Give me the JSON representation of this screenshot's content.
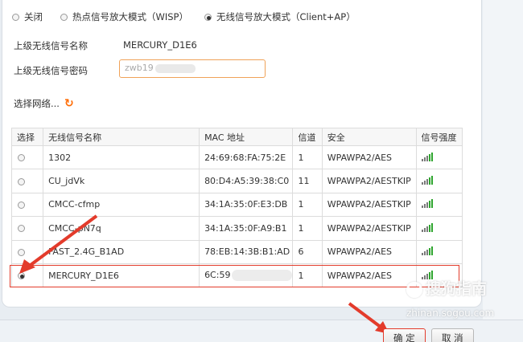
{
  "modes": [
    {
      "label": "关闭",
      "checked": false
    },
    {
      "label": "热点信号放大模式（WISP）",
      "checked": false
    },
    {
      "label": "无线信号放大模式（Client+AP）",
      "checked": true
    }
  ],
  "upper_ssid_label": "上级无线信号名称",
  "upper_ssid_value": "MERCURY_D1E6",
  "upper_pw_label": "上级无线信号密码",
  "upper_pw_value": "zwb19",
  "scan_label": "选择网络...",
  "table": {
    "headers": [
      "选择",
      "无线信号名称",
      "MAC 地址",
      "信道",
      "安全",
      "信号强度"
    ],
    "rows": [
      {
        "ssid": "1302",
        "mac": "24:69:68:FA:75:2E",
        "channel": "1",
        "security": "WPAWPA2/AES",
        "selected": false
      },
      {
        "ssid": "CU_jdVk",
        "mac": "80:D4:A5:39:38:C0",
        "channel": "11",
        "security": "WPAWPA2/AESTKIP",
        "selected": false
      },
      {
        "ssid": "CMCC-cfmp",
        "mac": "34:1A:35:0F:E3:DB",
        "channel": "1",
        "security": "WPAWPA2/AESTKIP",
        "selected": false
      },
      {
        "ssid": "CMCC-pN7q",
        "mac": "34:1A:35:0F:A9:B1",
        "channel": "1",
        "security": "WPAWPA2/AESTKIP",
        "selected": false
      },
      {
        "ssid": "FAST_2.4G_B1AD",
        "mac": "78:EB:14:3B:B1:AD",
        "channel": "6",
        "security": "WPAWPA2/AES",
        "selected": false
      },
      {
        "ssid": "MERCURY_D1E6",
        "mac": "6C:59",
        "channel": "1",
        "security": "WPAWPA2/AES",
        "selected": true
      }
    ]
  },
  "buttons": {
    "ok": "确 定",
    "cancel": "取 消"
  },
  "watermark": {
    "text": "搜狗指南",
    "url": "zhinan.sogou.com"
  },
  "colors": {
    "accent": "#e33b2b",
    "input_border": "#f0a258",
    "signal": "#2ea52e"
  }
}
